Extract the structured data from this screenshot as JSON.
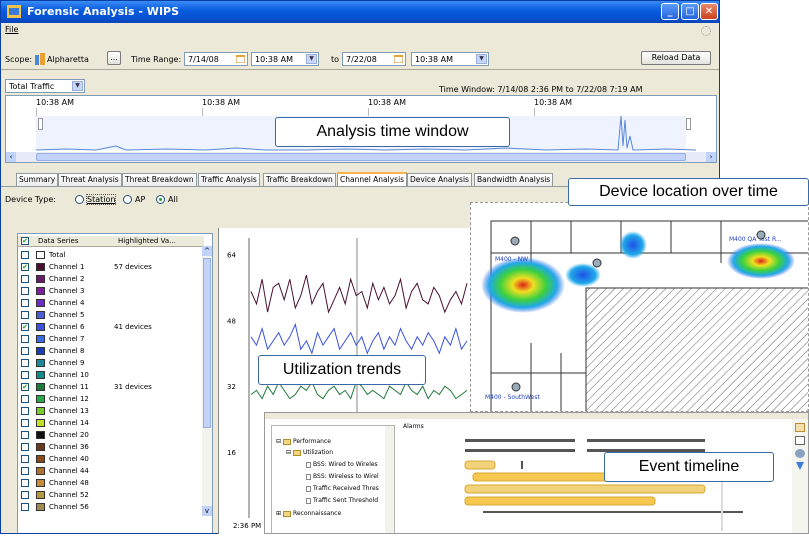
{
  "window": {
    "title": "Forensic Analysis - WIPS"
  },
  "menu": {
    "file": "File"
  },
  "toolbar": {
    "scope_label": "Scope:",
    "scope_value": "Alpharetta",
    "scope_browse": "...",
    "time_range_label": "Time Range:",
    "start_date": "7/14/08",
    "start_time": "10:38 AM",
    "to_label": "to",
    "end_date": "7/22/08",
    "end_time": "10:38 AM",
    "reload_button": "Reload Data"
  },
  "filter": {
    "metric_value": "Total Traffic",
    "time_window": "Time Window: 7/14/08 2:36 PM to 7/22/08 7:19 AM"
  },
  "overview": {
    "tick_labels": [
      "10:38 AM",
      "10:38 AM",
      "10:38 AM",
      "10:38 AM"
    ]
  },
  "tabs": [
    "Summary",
    "Threat Analysis",
    "Threat Breakdown",
    "Traffic Analysis",
    "Traffic Breakdown",
    "Channel Analysis",
    "Device Analysis",
    "Bandwidth Analysis"
  ],
  "active_tab": "Channel Analysis",
  "device_type": {
    "label": "Device Type:",
    "options": [
      "Station",
      "AP",
      "All"
    ],
    "selected": "All"
  },
  "series_table": {
    "header_series": "Data Series",
    "header_highlighted": "Highlighted Va...",
    "rows": [
      {
        "name": "Total",
        "checked": false,
        "color": "#ffffff",
        "count": ""
      },
      {
        "name": "Channel 1",
        "checked": true,
        "color": "#4a1030",
        "count": "57 devices"
      },
      {
        "name": "Channel 2",
        "checked": false,
        "color": "#6a1a6a",
        "count": ""
      },
      {
        "name": "Channel 3",
        "checked": false,
        "color": "#7b1f9a",
        "count": ""
      },
      {
        "name": "Channel 4",
        "checked": false,
        "color": "#6a2cc8",
        "count": ""
      },
      {
        "name": "Channel 5",
        "checked": false,
        "color": "#4a5ed8",
        "count": ""
      },
      {
        "name": "Channel 6",
        "checked": true,
        "color": "#3a52e0",
        "count": "41 devices"
      },
      {
        "name": "Channel 7",
        "checked": false,
        "color": "#3a6ae8",
        "count": ""
      },
      {
        "name": "Channel 8",
        "checked": false,
        "color": "#1c3cb8",
        "count": ""
      },
      {
        "name": "Channel 9",
        "checked": false,
        "color": "#1a8a9a",
        "count": ""
      },
      {
        "name": "Channel 10",
        "checked": false,
        "color": "#108a8a",
        "count": ""
      },
      {
        "name": "Channel 11",
        "checked": true,
        "color": "#1f7a3a",
        "count": "31 devices"
      },
      {
        "name": "Channel 12",
        "checked": false,
        "color": "#2aa84a",
        "count": ""
      },
      {
        "name": "Channel 13",
        "checked": false,
        "color": "#7acd2a",
        "count": ""
      },
      {
        "name": "Channel 14",
        "checked": false,
        "color": "#c4e02a",
        "count": ""
      },
      {
        "name": "Channel 20",
        "checked": false,
        "color": "#111111",
        "count": ""
      },
      {
        "name": "Channel 36",
        "checked": false,
        "color": "#6a3a1a",
        "count": ""
      },
      {
        "name": "Channel 40",
        "checked": false,
        "color": "#8a4a1a",
        "count": ""
      },
      {
        "name": "Channel 44",
        "checked": false,
        "color": "#b07030",
        "count": ""
      },
      {
        "name": "Channel 48",
        "checked": false,
        "color": "#c88a3a",
        "count": ""
      },
      {
        "name": "Channel 52",
        "checked": false,
        "color": "#b09a40",
        "count": ""
      },
      {
        "name": "Channel 56",
        "checked": false,
        "color": "#a08a50",
        "count": ""
      }
    ]
  },
  "chart_data": {
    "type": "line",
    "yticks": [
      64,
      48,
      32,
      16
    ],
    "x_label": "2:36 PM",
    "series": [
      {
        "color": "#4a1030",
        "values": [
          55,
          52,
          58,
          50,
          56,
          57,
          53,
          58,
          51,
          54,
          59,
          52,
          55,
          57,
          50,
          53,
          56,
          52,
          58,
          54,
          55,
          51,
          57,
          53,
          56,
          52,
          54,
          58,
          51,
          55,
          57,
          53,
          52,
          56,
          54,
          50,
          53,
          55,
          52,
          57
        ]
      },
      {
        "color": "#3a52e0",
        "values": [
          44,
          42,
          46,
          41,
          43,
          45,
          42,
          44,
          47,
          41,
          43,
          40,
          45,
          42,
          44,
          46,
          41,
          43,
          45,
          42,
          44,
          40,
          43,
          45,
          41,
          44,
          42,
          46,
          43,
          41,
          44,
          42,
          45,
          43,
          40,
          44,
          42,
          46,
          41,
          43
        ]
      },
      {
        "color": "#1f7a3a",
        "values": [
          30,
          31,
          29,
          32,
          30,
          33,
          31,
          29,
          30,
          32,
          31,
          33,
          30,
          29,
          31,
          32,
          30,
          31,
          29,
          33,
          32,
          30,
          31,
          30,
          29,
          32,
          31,
          30,
          33,
          31,
          30,
          32,
          29,
          31,
          30,
          32,
          31,
          29,
          30,
          31
        ]
      }
    ]
  },
  "heatmap": {
    "labels": [
      "M400 - NW",
      "M400 QA Test R...",
      "M400 - SouthWest"
    ]
  },
  "alarms": {
    "header": "Alarms",
    "tree": [
      "Performance",
      "Utilization",
      "BSS: Wired to Wireles",
      "BSS: Wireless to Wirel",
      "Traffic Received Thres",
      "Traffic Sent Threshold",
      "Reconnaissance"
    ]
  },
  "callouts": {
    "analysis_window": "Analysis time window",
    "device_location": "Device location over time",
    "utilization": "Utilization trends",
    "event_timeline": "Event timeline"
  }
}
